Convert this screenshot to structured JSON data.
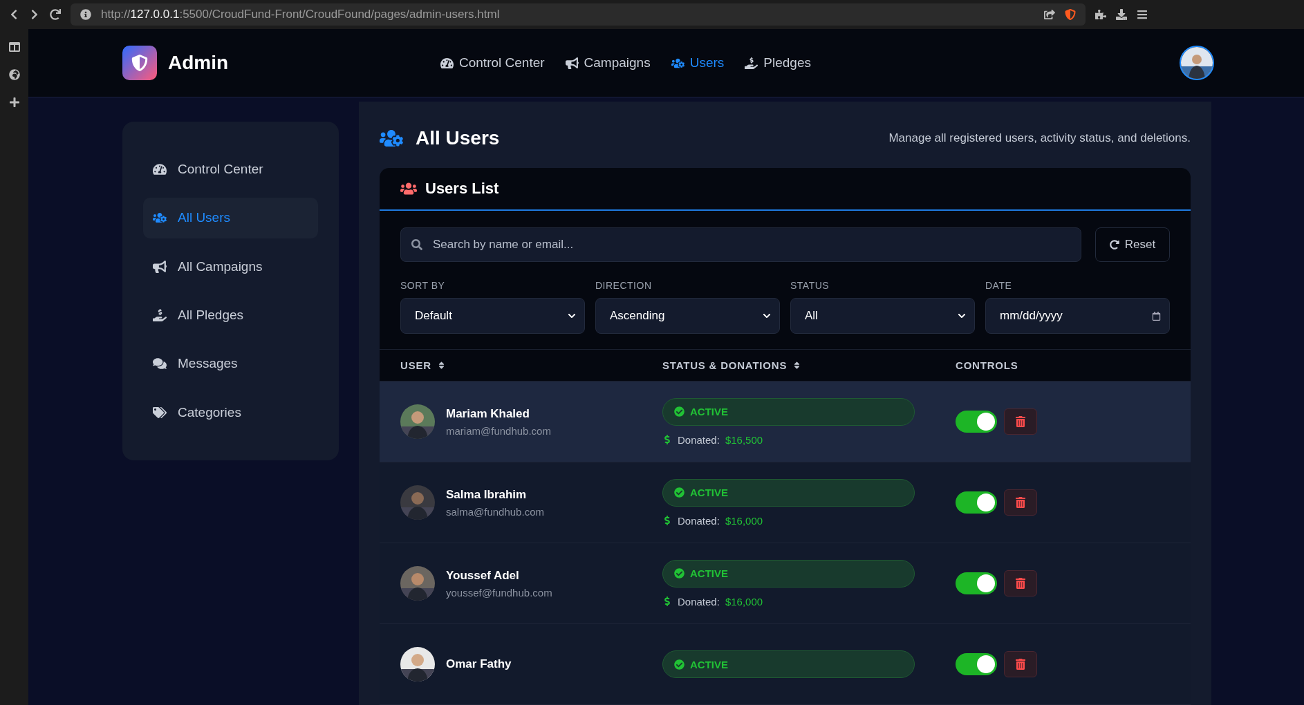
{
  "browser": {
    "url_scheme": "http://",
    "url_host": "127.0.0.1",
    "url_path": ":5500/CroudFund-Front/CroudFound/pages/admin-users.html"
  },
  "header": {
    "brand": "Admin",
    "nav": [
      {
        "label": "Control Center",
        "selected": false
      },
      {
        "label": "Campaigns",
        "selected": false
      },
      {
        "label": "Users",
        "selected": true
      },
      {
        "label": "Pledges",
        "selected": false
      }
    ]
  },
  "sidebar": {
    "items": [
      {
        "label": "Control Center",
        "selected": false
      },
      {
        "label": "All Users",
        "selected": true
      },
      {
        "label": "All Campaigns",
        "selected": false
      },
      {
        "label": "All Pledges",
        "selected": false
      },
      {
        "label": "Messages",
        "selected": false
      },
      {
        "label": "Categories",
        "selected": false
      }
    ]
  },
  "page": {
    "title": "All Users",
    "subtitle": "Manage all registered users, activity status, and deletions."
  },
  "card": {
    "title": "Users List",
    "search": {
      "placeholder": "Search by name or email..."
    },
    "reset": "Reset",
    "filters": [
      {
        "kind": "select",
        "label": "SORT BY",
        "value": "Default"
      },
      {
        "kind": "select",
        "label": "DIRECTION",
        "value": "Ascending"
      },
      {
        "kind": "select",
        "label": "STATUS",
        "value": "All"
      },
      {
        "kind": "date",
        "label": "DATE",
        "placeholder": "mm/dd/yyyy"
      }
    ]
  },
  "table": {
    "columns": [
      {
        "label": "USER",
        "sortable": true
      },
      {
        "label": "STATUS & DONATIONS",
        "sortable": true
      },
      {
        "label": "CONTROLS",
        "sortable": false
      }
    ],
    "rows": [
      {
        "name": "Mariam Khaled",
        "email": "mariam@fundhub.com",
        "status": "ACTIVE",
        "donated_label": "Donated:",
        "donated": "$16,500",
        "on": true,
        "selected": true
      },
      {
        "name": "Salma Ibrahim",
        "email": "salma@fundhub.com",
        "status": "ACTIVE",
        "donated_label": "Donated:",
        "donated": "$16,000",
        "on": true,
        "selected": false
      },
      {
        "name": "Youssef Adel",
        "email": "youssef@fundhub.com",
        "status": "ACTIVE",
        "donated_label": "Donated:",
        "donated": "$16,000",
        "on": true,
        "selected": false
      },
      {
        "name": "Omar Fathy",
        "status": "ACTIVE",
        "on": true,
        "selected": false
      }
    ]
  }
}
